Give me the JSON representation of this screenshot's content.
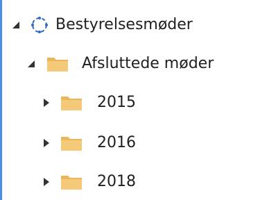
{
  "tree": {
    "root": {
      "label": "Bestyrelsesmøder",
      "expanded": true,
      "icon": "site-circle-icon",
      "children": [
        {
          "label": "Afsluttede møder",
          "expanded": true,
          "icon": "folder-icon",
          "children": [
            {
              "label": "2015",
              "expanded": false,
              "icon": "folder-icon"
            },
            {
              "label": "2016",
              "expanded": false,
              "icon": "folder-icon"
            },
            {
              "label": "2018",
              "expanded": false,
              "icon": "folder-icon"
            }
          ]
        }
      ]
    }
  },
  "colors": {
    "folder": "#f5c97a",
    "folder_dark": "#e9b65a",
    "site_circle": "#2b6cc4",
    "expander": "#333333",
    "accent_edge": "#4a90e2"
  }
}
